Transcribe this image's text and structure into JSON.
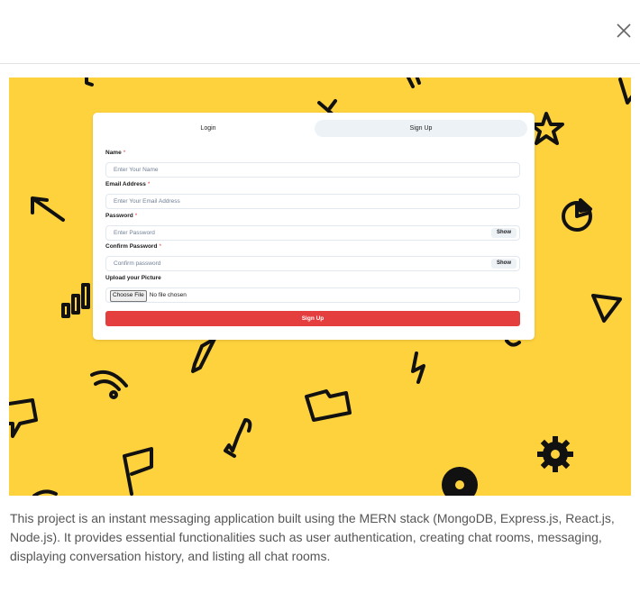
{
  "modal": {
    "close_icon": "close-icon",
    "description": "This project is an instant messaging application built using the MERN stack (MongoDB, Express.js, React.js, Node.js). It provides essential functionalities such as user authentication, creating chat rooms, messaging, displaying conversation history, and listing all chat rooms."
  },
  "preview": {
    "background_color": "#fdd23d",
    "decorations": [
      "arrow-icon",
      "star-icon",
      "pie-chart-icon",
      "bar-chart-icon",
      "triangle-icon",
      "pencil-icon",
      "wifi-icon",
      "lightning-icon",
      "folder-icon",
      "speech-bubble-icon",
      "wrench-icon",
      "flag-icon",
      "gear-icon",
      "record-icon"
    ],
    "form": {
      "tabs": [
        {
          "label": "Login"
        },
        {
          "label": "Sign Up"
        }
      ],
      "fields": {
        "name": {
          "label": "Name",
          "placeholder": "Enter Your Name"
        },
        "email": {
          "label": "Email Address",
          "placeholder": "Enter Your Email Address"
        },
        "password": {
          "label": "Password",
          "placeholder": "Enter Password",
          "toggle": "Show"
        },
        "confirm": {
          "label": "Confirm Password",
          "placeholder": "Confirm password",
          "toggle": "Show"
        },
        "picture": {
          "label": "Upload your Picture",
          "button": "Choose File",
          "status": "No file chosen"
        }
      },
      "required_marker": "*",
      "submit_label": "Sign Up",
      "submit_color": "#e53e3e"
    }
  }
}
